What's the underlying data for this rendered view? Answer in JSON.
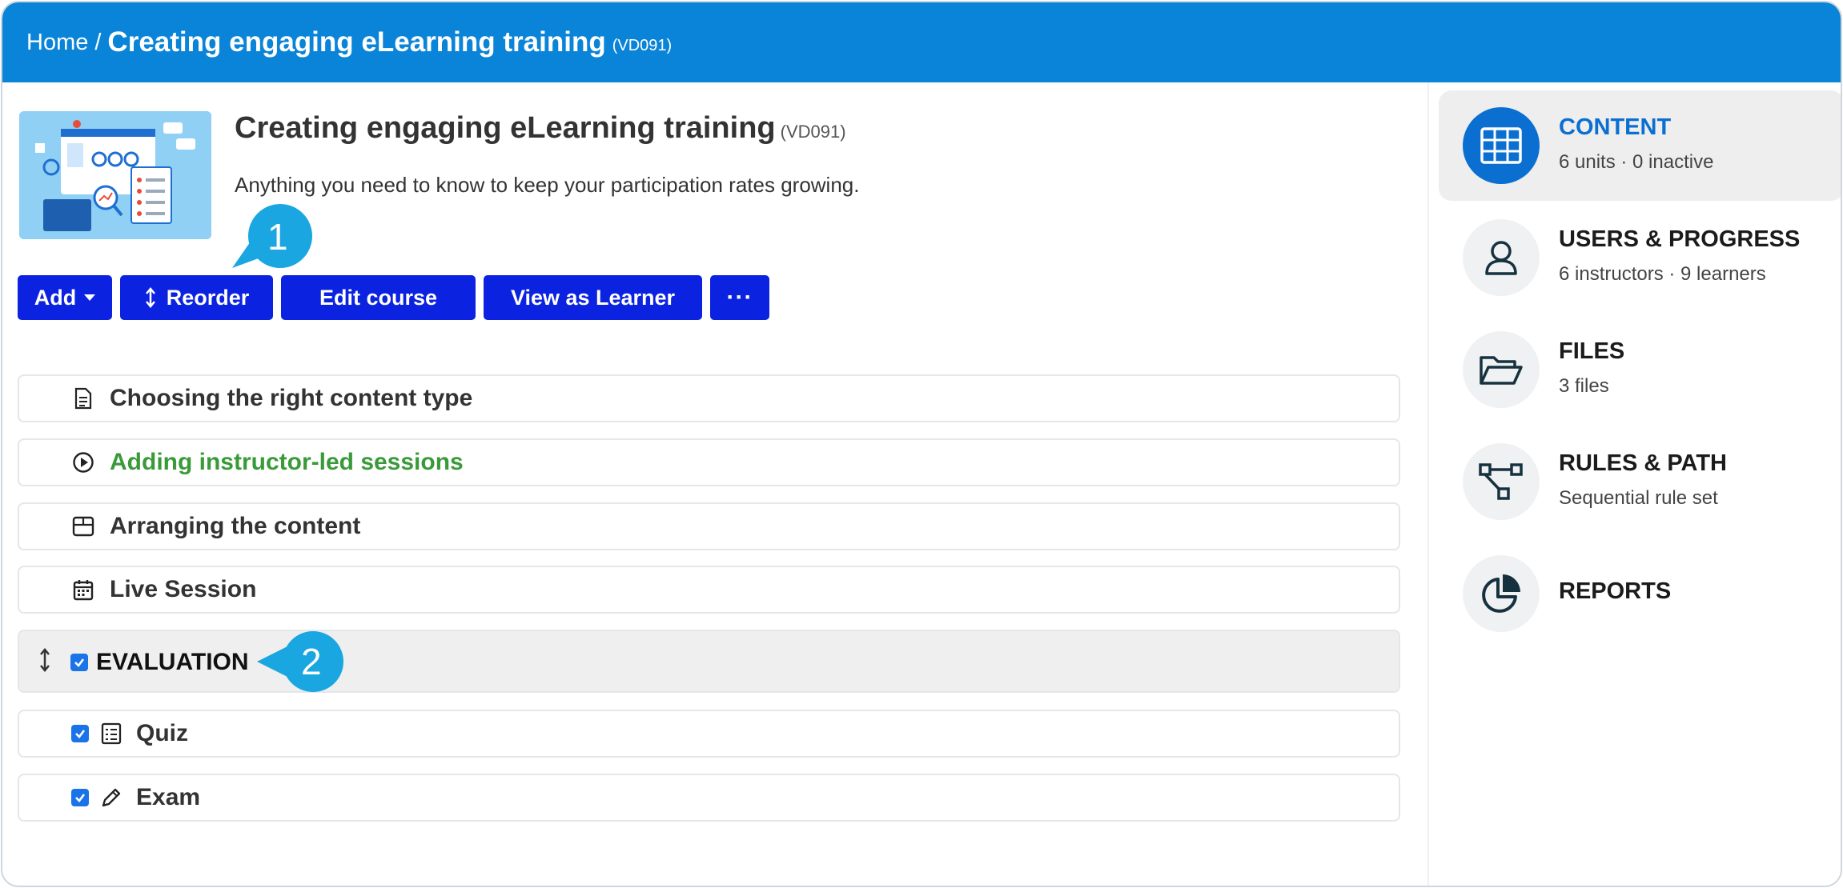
{
  "breadcrumb": {
    "home": "Home",
    "separator": "/",
    "title": "Creating engaging eLearning training",
    "code": "(VD091)"
  },
  "course": {
    "title": "Creating engaging eLearning training",
    "code": "(VD091)",
    "description": "Anything you need to know to keep your participation rates growing."
  },
  "toolbar": {
    "add": "Add",
    "reorder": "Reorder",
    "edit": "Edit course",
    "view": "View as Learner",
    "more": "···"
  },
  "callouts": [
    "1",
    "2"
  ],
  "units": [
    {
      "label": "Choosing the right content type",
      "icon": "document-icon"
    },
    {
      "label": "Adding instructor-led sessions",
      "icon": "play-circle-icon"
    },
    {
      "label": "Arranging the content",
      "icon": "box-icon"
    },
    {
      "label": "Live Session",
      "icon": "calendar-icon"
    }
  ],
  "section": {
    "label": "EVALUATION",
    "checked": true
  },
  "section_units": [
    {
      "label": "Quiz",
      "icon": "checklist-icon",
      "checked": true
    },
    {
      "label": "Exam",
      "icon": "pencil-icon",
      "checked": true
    }
  ],
  "sidebar": [
    {
      "title": "CONTENT",
      "sub": "6 units · 0 inactive",
      "icon": "grid-icon",
      "active": true
    },
    {
      "title": "USERS & PROGRESS",
      "sub": "6 instructors · 9 learners",
      "icon": "user-icon"
    },
    {
      "title": "FILES",
      "sub": "3 files",
      "icon": "folder-icon"
    },
    {
      "title": "RULES & PATH",
      "sub": "Sequential rule set",
      "icon": "flow-icon"
    },
    {
      "title": "REPORTS",
      "sub": "",
      "icon": "pie-chart-icon"
    }
  ],
  "colors": {
    "header": "#0a84d8",
    "button": "#0b22e0",
    "callout": "#1aa6e0",
    "active": "#0a6fd1",
    "green": "#3a9a3a"
  }
}
